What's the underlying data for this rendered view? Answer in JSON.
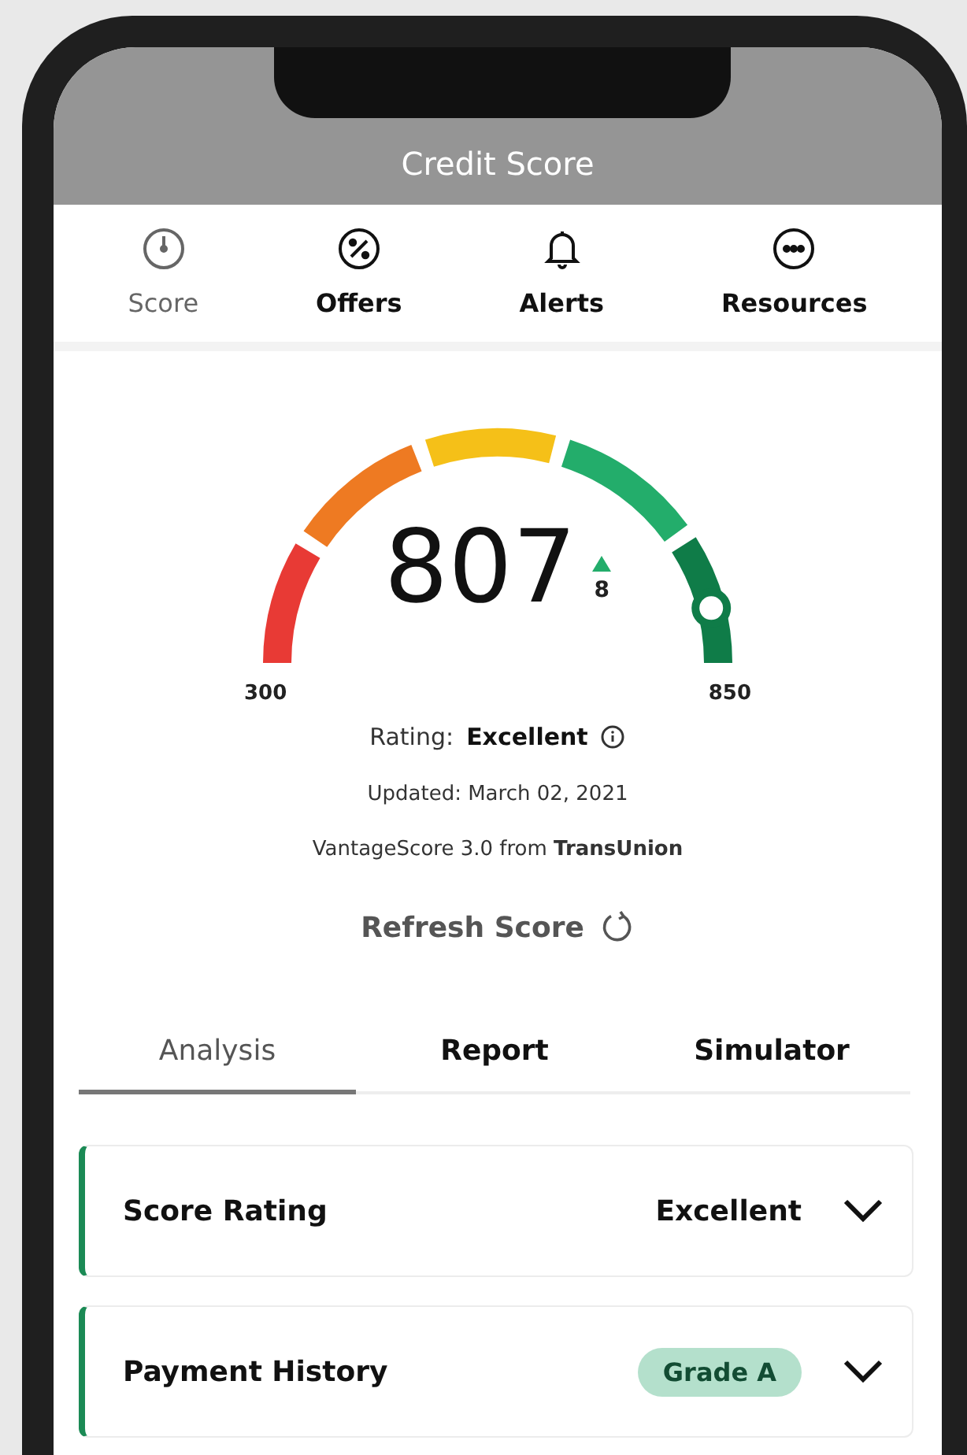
{
  "header": {
    "title": "Credit Score"
  },
  "nav": [
    {
      "label": "Score",
      "selected": true
    },
    {
      "label": "Offers",
      "selected": false
    },
    {
      "label": "Alerts",
      "selected": false
    },
    {
      "label": "Resources",
      "selected": false
    }
  ],
  "gauge": {
    "score": "807",
    "level": 0.92,
    "change": {
      "rising": true,
      "value": "8"
    },
    "min": "300",
    "max": "850"
  },
  "rating": {
    "label": "Rating:",
    "value": "Excellent"
  },
  "updated": "Updated: March 02, 2021",
  "source": "VantageScore 3.0 from **TransUnion**",
  "refresh": "Refresh Score",
  "tabs": [
    {
      "label": "Analysis",
      "selected": true
    },
    {
      "label": "Report",
      "selected": false
    },
    {
      "label": "Simulator",
      "selected": false
    }
  ],
  "cards": [
    {
      "title": "Score Rating",
      "kind": "text",
      "value": "Excellent",
      "expanded": false
    },
    {
      "title": "Payment History",
      "kind": "badge",
      "value": "Grade A",
      "expanded": false
    }
  ]
}
